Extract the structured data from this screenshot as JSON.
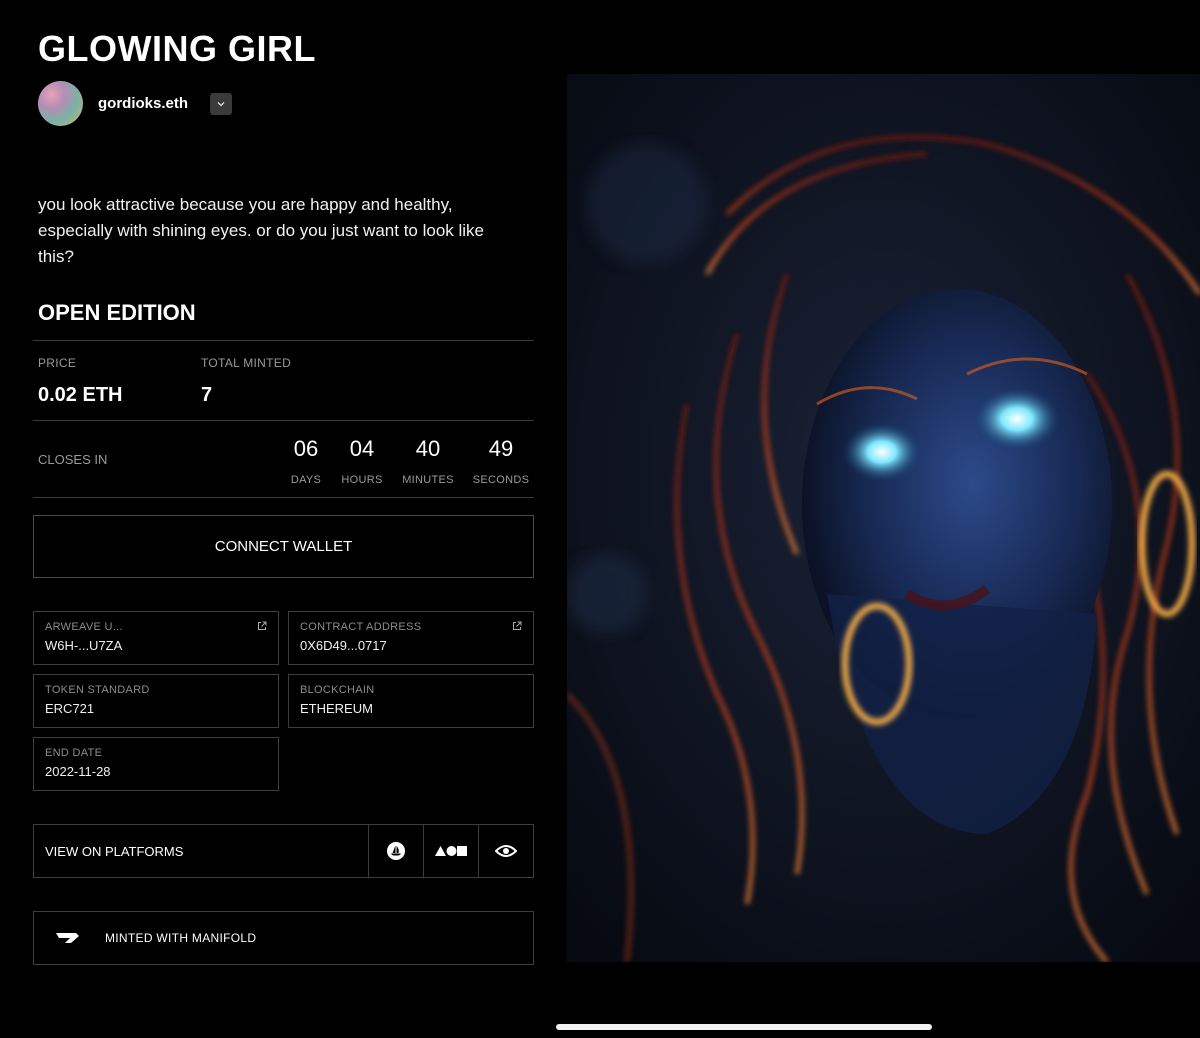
{
  "title": "GLOWING GIRL",
  "creator": {
    "name": "gordioks.eth",
    "dropdown_icon": "chevron-down-icon"
  },
  "description": "you look attractive because you are happy and healthy, especially with shining eyes. or do you just want to look like this?",
  "edition": "OPEN EDITION",
  "stats": {
    "price_label": "PRICE",
    "price_value": "0.02 ETH",
    "minted_label": "TOTAL MINTED",
    "minted_value": "7"
  },
  "countdown": {
    "label": "CLOSES IN",
    "units": [
      {
        "value": "06",
        "label": "DAYS"
      },
      {
        "value": "04",
        "label": "HOURS"
      },
      {
        "value": "40",
        "label": "MINUTES"
      },
      {
        "value": "49",
        "label": "SECONDS"
      }
    ]
  },
  "connect_wallet": "CONNECT WALLET",
  "details": {
    "arweave": {
      "label": "ARWEAVE U...",
      "value": "W6H-...U7ZA",
      "icon": "external-link-icon"
    },
    "contract": {
      "label": "CONTRACT ADDRESS",
      "value": "0X6D49...0717",
      "icon": "external-link-icon"
    },
    "token_standard": {
      "label": "TOKEN STANDARD",
      "value": "ERC721"
    },
    "blockchain": {
      "label": "BLOCKCHAIN",
      "value": "ETHEREUM"
    },
    "end_date": {
      "label": "END DATE",
      "value": "2022-11-28"
    }
  },
  "platforms": {
    "label": "VIEW ON PLATFORMS",
    "icons": [
      "opensea-icon",
      "foundation-icon",
      "eye-icon"
    ]
  },
  "manifold": {
    "label": "MINTED WITH MANIFOLD",
    "icon": "manifold-logo-icon"
  },
  "colors": {
    "background": "#000000",
    "border": "#3d3d3d",
    "muted_text": "#9a9a9a"
  }
}
